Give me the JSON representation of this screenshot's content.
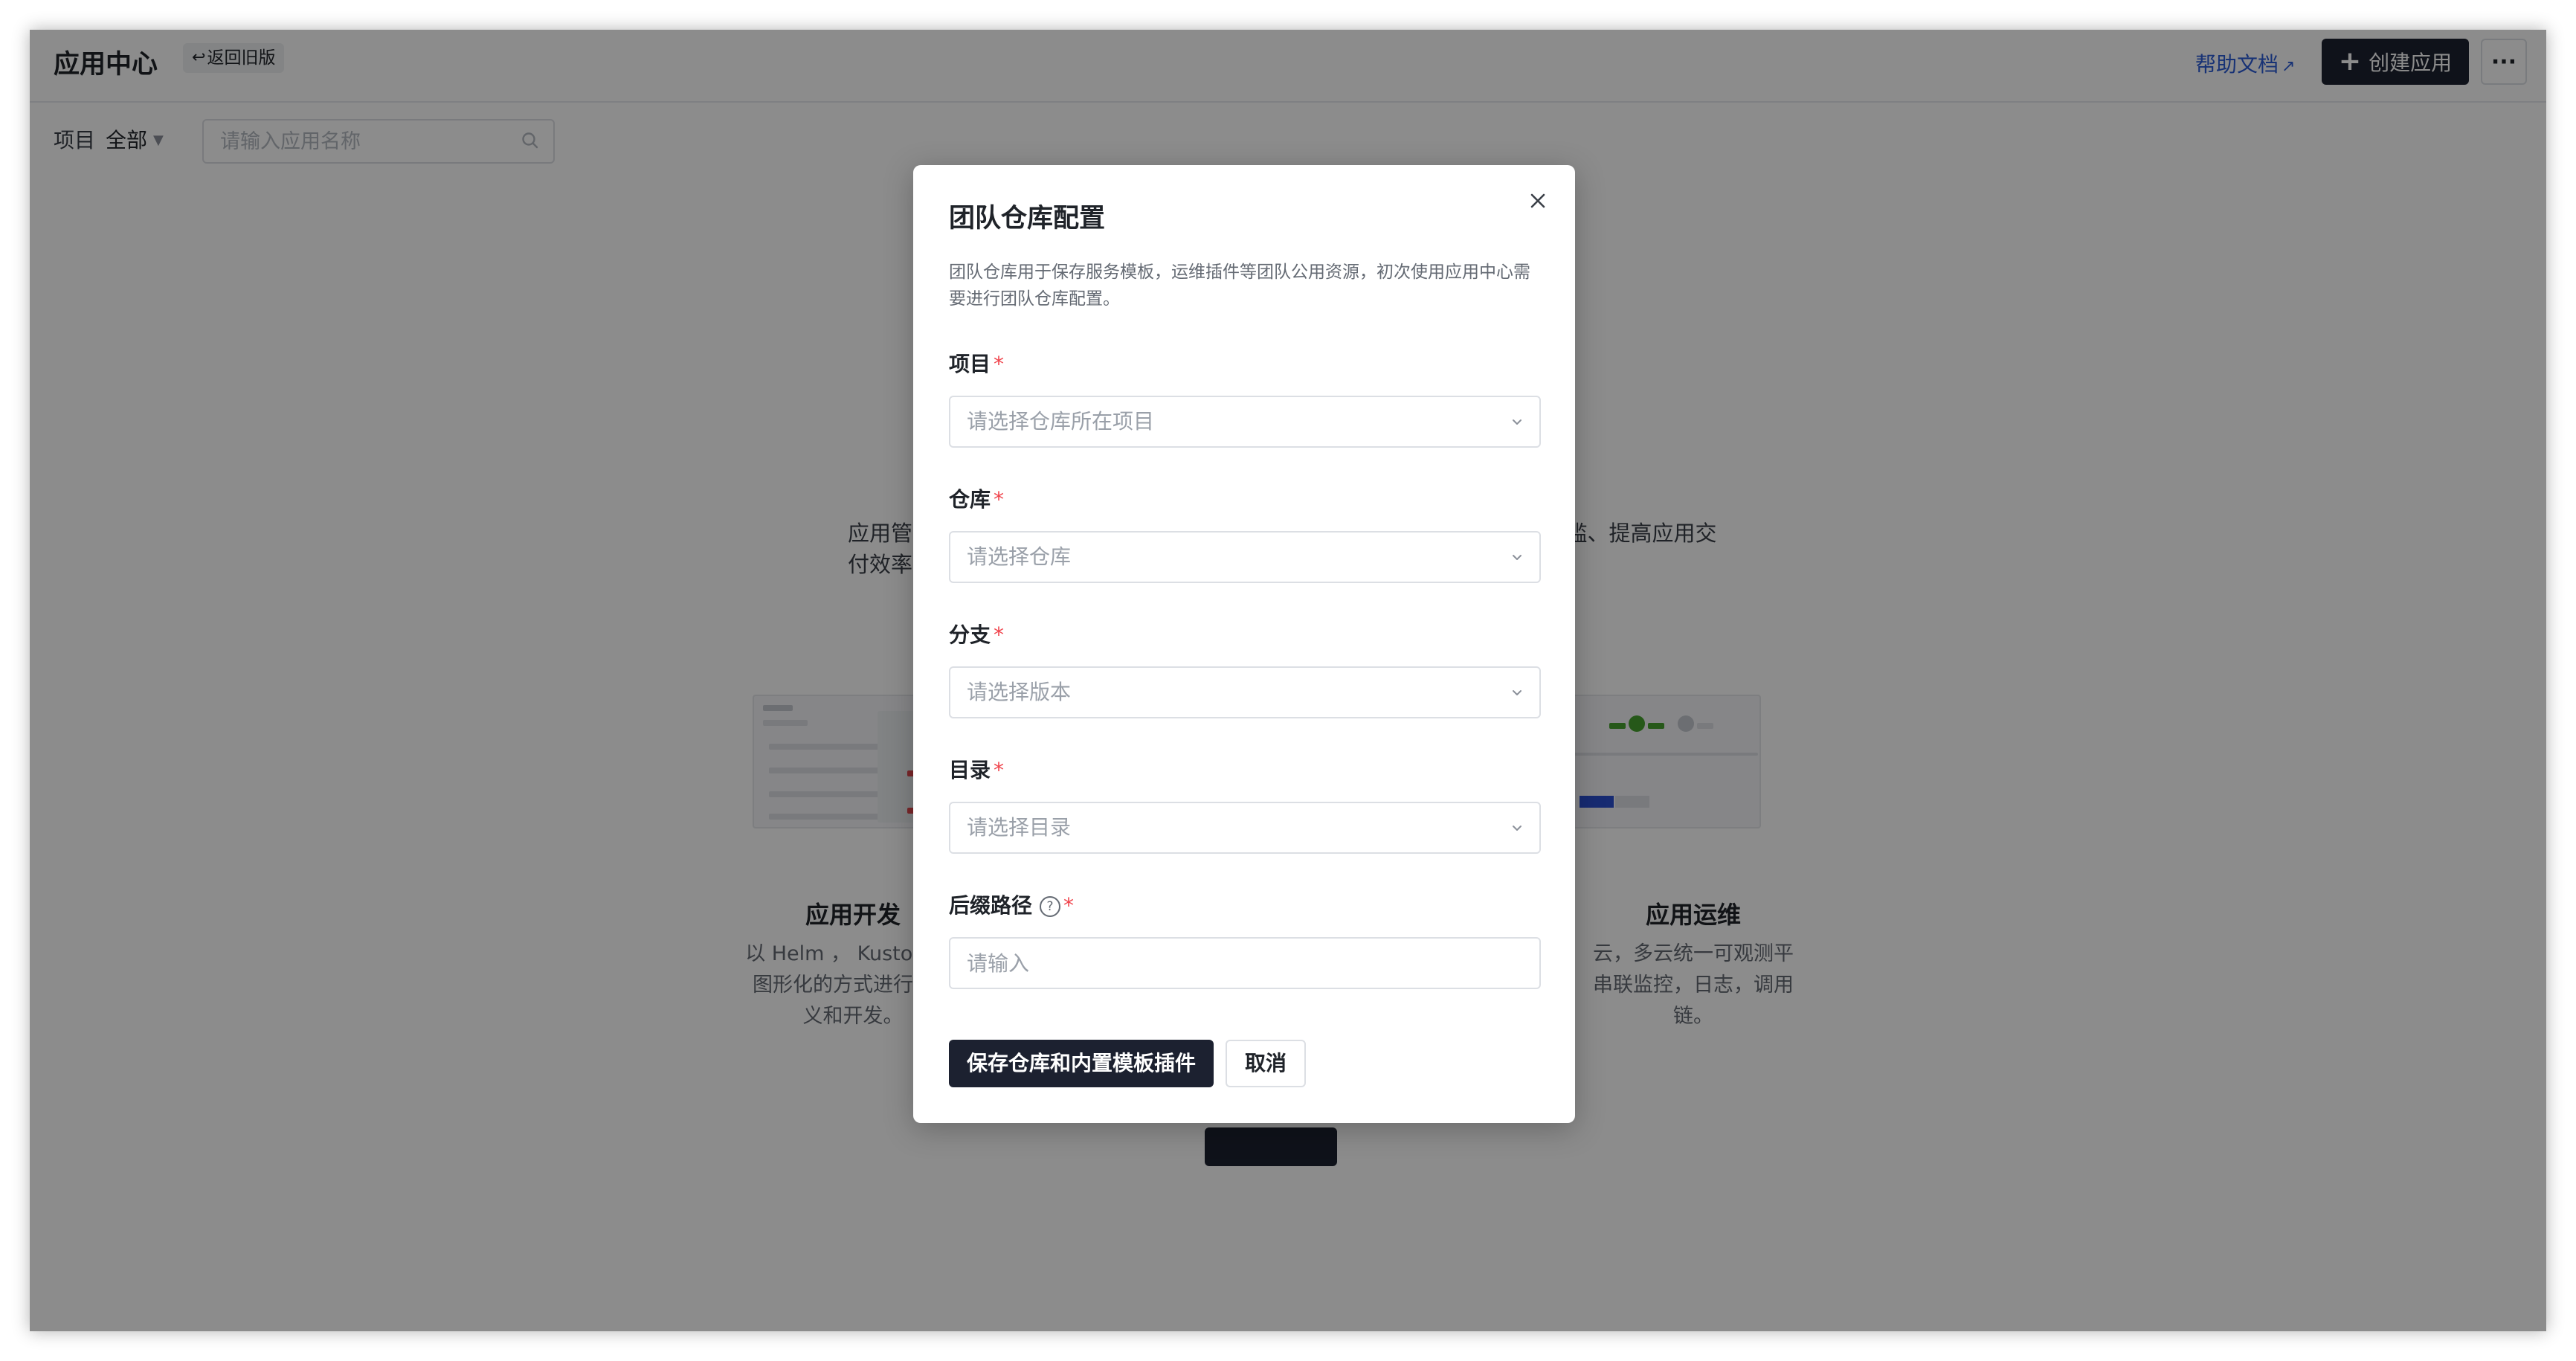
{
  "header": {
    "title": "应用中心",
    "back_label": "返回旧版",
    "help_label": "帮助文档",
    "create_label": "创建应用",
    "more_label": "···"
  },
  "filter": {
    "project_label": "项目",
    "project_value": "全部",
    "search_placeholder": "请输入应用名称"
  },
  "main": {
    "intro_left": "应用管",
    "intro_left_2": "付效率",
    "intro_right": "槛、提高应用交",
    "features": [
      {
        "title": "应用开发",
        "desc_lines": [
          "以 Helm ， Kustomize",
          "图形化的方式进行云原",
          "义和开发。"
        ]
      },
      {
        "title": "应用运维",
        "desc_lines": [
          "云，多云统一可观测平",
          "串联监控，日志，调用",
          "链。"
        ]
      }
    ]
  },
  "modal": {
    "title": "团队仓库配置",
    "description": "团队仓库用于保存服务模板，运维插件等团队公用资源，初次使用应用中心需要进行团队仓库配置。",
    "required_mark": "*",
    "fields": [
      {
        "label": "项目",
        "placeholder": "请选择仓库所在项目"
      },
      {
        "label": "仓库",
        "placeholder": "请选择仓库"
      },
      {
        "label": "分支",
        "placeholder": "请选择版本"
      },
      {
        "label": "目录",
        "placeholder": "请选择目录"
      }
    ],
    "suffix_field": {
      "label": "后缀路径",
      "help": "?",
      "placeholder": "请输入"
    },
    "save_label": "保存仓库和内置模板插件",
    "cancel_label": "取消"
  },
  "colors": {
    "primary_dark": "#1c2130",
    "link_blue": "#2a5bd6",
    "required_red": "#f0444c",
    "overlay": "rgba(0,0,0,0.45)"
  }
}
